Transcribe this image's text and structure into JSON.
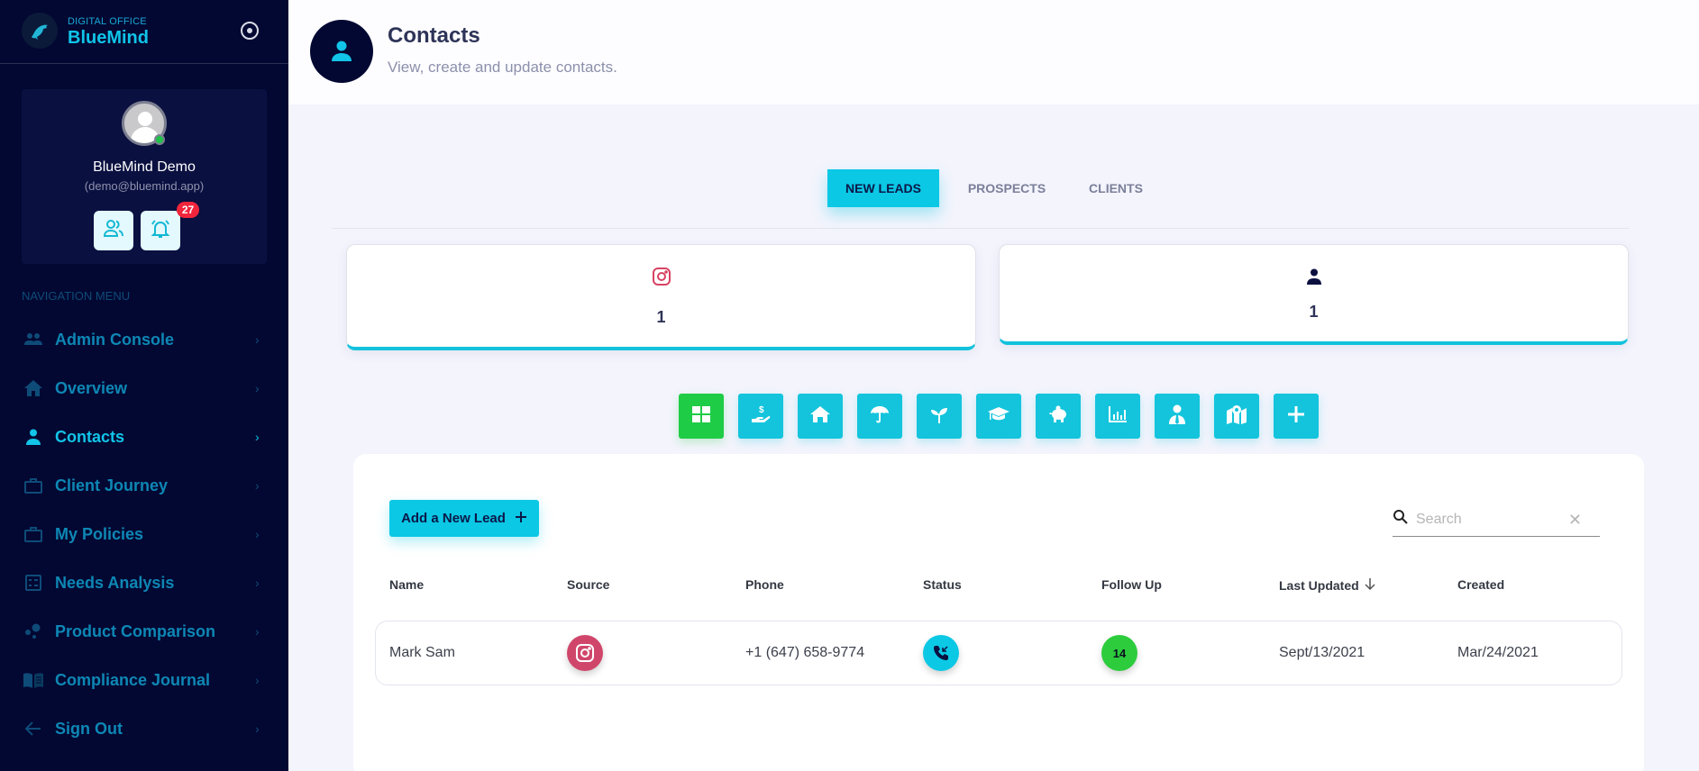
{
  "brand": {
    "subtitle": "DIGITAL OFFICE",
    "title": "BlueMind"
  },
  "profile": {
    "name": "BlueMind Demo",
    "email": "(demo@bluemind.app)",
    "notification_count": "27"
  },
  "nav": {
    "heading": "NAVIGATION MENU",
    "items": [
      {
        "label": "Admin Console",
        "icon": "admin-users-icon",
        "active": false
      },
      {
        "label": "Overview",
        "icon": "home-icon",
        "active": false
      },
      {
        "label": "Contacts",
        "icon": "person-icon",
        "active": true
      },
      {
        "label": "Client Journey",
        "icon": "briefcase-icon",
        "active": false
      },
      {
        "label": "My Policies",
        "icon": "briefcase-icon",
        "active": false
      },
      {
        "label": "Needs Analysis",
        "icon": "grid-list-icon",
        "active": false
      },
      {
        "label": "Product Comparison",
        "icon": "bubbles-icon",
        "active": false
      },
      {
        "label": "Compliance Journal",
        "icon": "book-icon",
        "active": false
      },
      {
        "label": "Sign Out",
        "icon": "arrow-left-icon",
        "active": false
      }
    ]
  },
  "header": {
    "title": "Contacts",
    "subtitle": "View, create and update contacts."
  },
  "tabs": [
    {
      "label": "NEW LEADS",
      "active": true
    },
    {
      "label": "PROSPECTS",
      "active": false
    },
    {
      "label": "CLIENTS",
      "active": false
    }
  ],
  "stats": [
    {
      "icon": "instagram-icon",
      "value": "1"
    },
    {
      "icon": "person-icon",
      "value": "1"
    }
  ],
  "categories": [
    {
      "icon": "grid-icon",
      "active": true
    },
    {
      "icon": "hand-money-icon",
      "active": false
    },
    {
      "icon": "home-icon",
      "active": false
    },
    {
      "icon": "umbrella-icon",
      "active": false
    },
    {
      "icon": "sprout-icon",
      "active": false
    },
    {
      "icon": "graduation-cap-icon",
      "active": false
    },
    {
      "icon": "piggy-bank-icon",
      "active": false
    },
    {
      "icon": "bar-chart-icon",
      "active": false
    },
    {
      "icon": "businessman-icon",
      "active": false
    },
    {
      "icon": "map-pin-icon",
      "active": false
    },
    {
      "icon": "plus-icon",
      "active": false
    }
  ],
  "table": {
    "add_button_label": "Add a New Lead",
    "search_placeholder": "Search",
    "search_value": "",
    "columns": [
      "Name",
      "Source",
      "Phone",
      "Status",
      "Follow Up",
      "Last Updated",
      "Created"
    ],
    "sort_column": "Last Updated",
    "rows": [
      {
        "name": "Mark Sam",
        "source": "instagram",
        "phone": "+1 (647) 658-9774",
        "status": "phone-incoming",
        "follow_up": "14",
        "last_updated": "Sept/13/2021",
        "created": "Mar/24/2021"
      }
    ]
  },
  "colors": {
    "sidebar_bg": "#020832",
    "accent": "#0bc8e5",
    "active_green": "#1fcc45",
    "instagram": "#d0466b",
    "badge_red": "#f0253c"
  }
}
